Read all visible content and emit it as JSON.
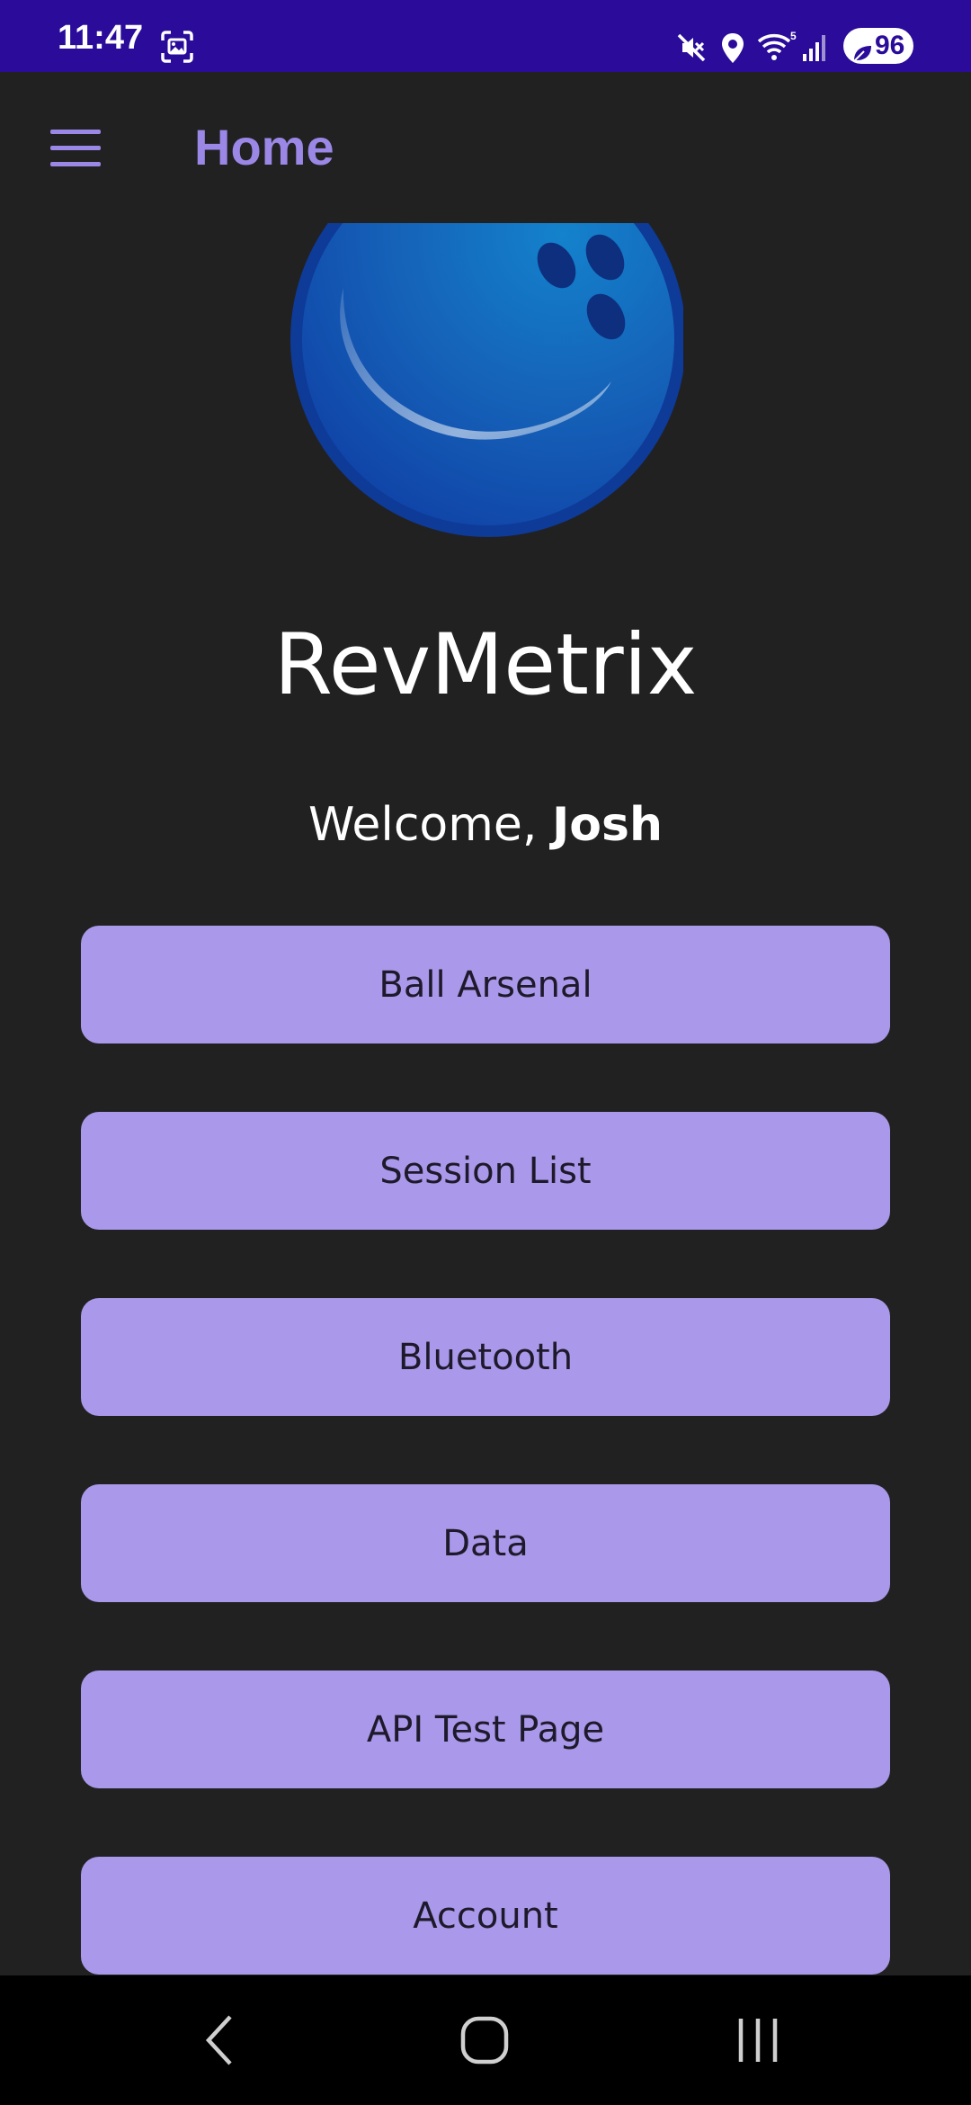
{
  "status_bar": {
    "time": "11:47",
    "battery": "96",
    "background_color": "#2a0b9a",
    "icons": [
      "screenshot-icon",
      "mute-icon",
      "location-icon",
      "wifi-icon",
      "signal-icon",
      "battery-saver-icon"
    ]
  },
  "app_bar": {
    "title": "Home",
    "menu_icon": "hamburger-menu-icon",
    "accent_color": "#9b87e6"
  },
  "logo": {
    "icon": "bowling-ball-icon"
  },
  "main": {
    "app_name": "RevMetrix",
    "welcome_prefix": "Welcome, ",
    "user_name": "Josh",
    "buttons": [
      {
        "label": "Ball Arsenal"
      },
      {
        "label": "Session List"
      },
      {
        "label": "Bluetooth"
      },
      {
        "label": "Data"
      },
      {
        "label": "API Test Page"
      },
      {
        "label": "Account"
      }
    ],
    "button_color": "#aa98ea",
    "background_color": "#212121"
  },
  "system_nav": {
    "icons": [
      "back-icon",
      "home-icon",
      "recents-icon"
    ]
  }
}
